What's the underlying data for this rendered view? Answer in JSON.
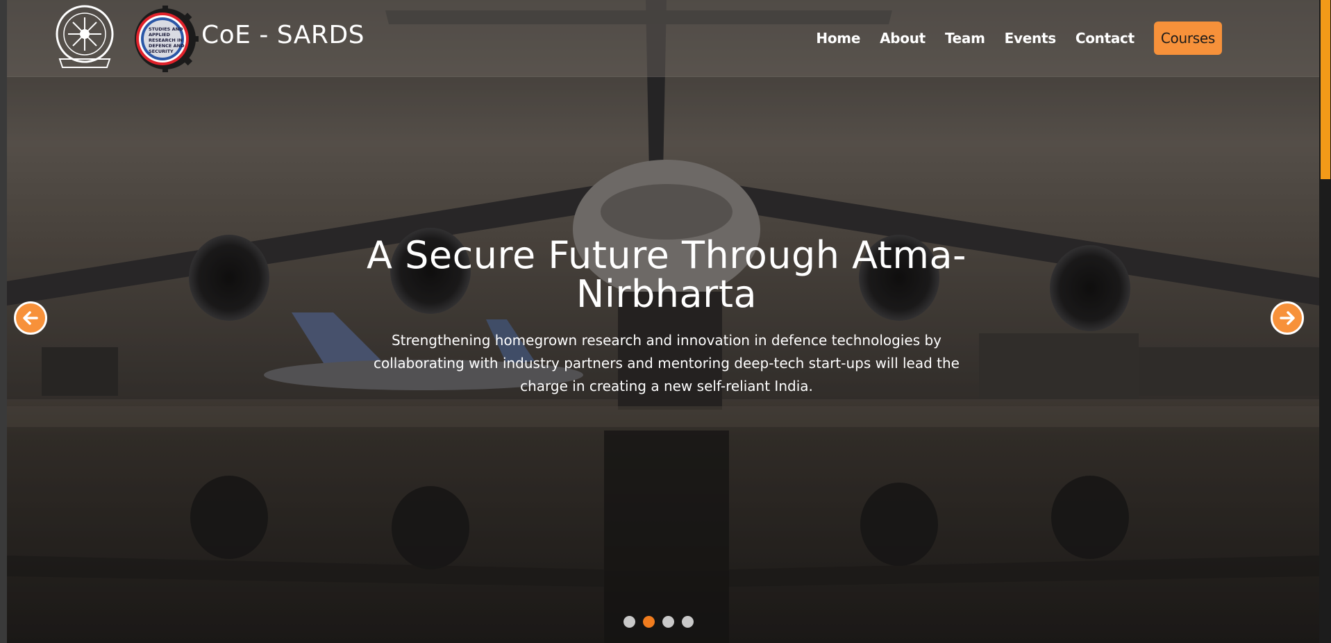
{
  "header": {
    "brand": "CoE - SARDS",
    "logo_left_icon": "iit-emblem-icon",
    "logo_right_icon": "sards-logo-icon",
    "sards_logo_text": [
      "STUDIES AND",
      "APPLIED",
      "RESEARCH IN",
      "DEFENCE AND",
      "SECURITY"
    ],
    "nav": {
      "home": "Home",
      "about": "About",
      "team": "Team",
      "events": "Events",
      "contact": "Contact",
      "courses": "Courses"
    }
  },
  "hero": {
    "title_line1": "A Secure Future Through Atma-",
    "title_line2": "Nirbharta",
    "description_line1": "Strengthening homegrown research and innovation in defence technologies by",
    "description_line2": "collaborating with industry partners and mentoring deep-tech start-ups will lead the",
    "description_line3": "charge in creating a new self-reliant India.",
    "background_icon": "military-aircraft-image"
  },
  "carousel": {
    "prev_icon": "arrow-left-icon",
    "next_icon": "arrow-right-icon",
    "slide_count": 4,
    "active_slide": 2
  },
  "colors": {
    "accent": "#f7913a",
    "dot_active": "#f07c1e",
    "dot_inactive": "#c9c9c9",
    "scroll_thumb": "#f39a18"
  }
}
